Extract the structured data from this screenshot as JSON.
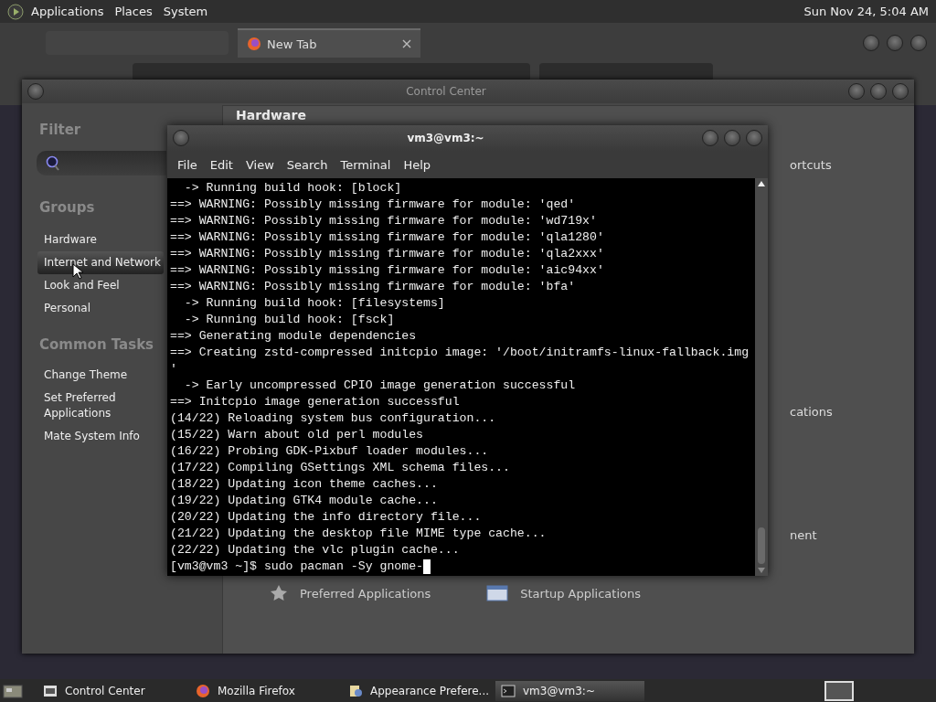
{
  "top_panel": {
    "menus": [
      "Applications",
      "Places",
      "System"
    ],
    "clock": "Sun Nov 24,  5:04 AM"
  },
  "browser": {
    "tabs": [
      {
        "label": "New Tab",
        "selected": true
      }
    ]
  },
  "control_center": {
    "title": "Control Center",
    "filter_heading": "Filter",
    "groups_heading": "Groups",
    "groups": [
      {
        "label": "Hardware",
        "selected": false
      },
      {
        "label": "Internet and Network",
        "selected": true
      },
      {
        "label": "Look and Feel",
        "selected": false
      },
      {
        "label": "Personal",
        "selected": false
      }
    ],
    "tasks_heading": "Common Tasks",
    "tasks": [
      "Change Theme",
      "Set Preferred Applications",
      "Mate System Info"
    ],
    "content_heading": "Hardware",
    "content_fragments": [
      "ortcuts",
      "cations",
      "nent"
    ],
    "bottom_items": [
      "Preferred Applications",
      "Startup Applications"
    ]
  },
  "terminal": {
    "title": "vm3@vm3:~",
    "menu": [
      "File",
      "Edit",
      "View",
      "Search",
      "Terminal",
      "Help"
    ],
    "lines": [
      "  -> Running build hook: [block]",
      "==> WARNING: Possibly missing firmware for module: 'qed'",
      "==> WARNING: Possibly missing firmware for module: 'wd719x'",
      "==> WARNING: Possibly missing firmware for module: 'qla1280'",
      "==> WARNING: Possibly missing firmware for module: 'qla2xxx'",
      "==> WARNING: Possibly missing firmware for module: 'aic94xx'",
      "==> WARNING: Possibly missing firmware for module: 'bfa'",
      "  -> Running build hook: [filesystems]",
      "  -> Running build hook: [fsck]",
      "==> Generating module dependencies",
      "==> Creating zstd-compressed initcpio image: '/boot/initramfs-linux-fallback.img",
      "'",
      "  -> Early uncompressed CPIO image generation successful",
      "==> Initcpio image generation successful",
      "(14/22) Reloading system bus configuration...",
      "(15/22) Warn about old perl modules",
      "(16/22) Probing GDK-Pixbuf loader modules...",
      "(17/22) Compiling GSettings XML schema files...",
      "(18/22) Updating icon theme caches...",
      "(19/22) Updating GTK4 module cache...",
      "(20/22) Updating the info directory file...",
      "(21/22) Updating the desktop file MIME type cache...",
      "(22/22) Updating the vlc plugin cache..."
    ],
    "prompt": "[vm3@vm3 ~]$ sudo pacman -Sy gnome-"
  },
  "taskbar": {
    "items": [
      {
        "label": "Control Center",
        "selected": false
      },
      {
        "label": "Mozilla Firefox",
        "selected": false
      },
      {
        "label": "Appearance Prefere...",
        "selected": false
      },
      {
        "label": "vm3@vm3:~",
        "selected": true
      }
    ]
  }
}
